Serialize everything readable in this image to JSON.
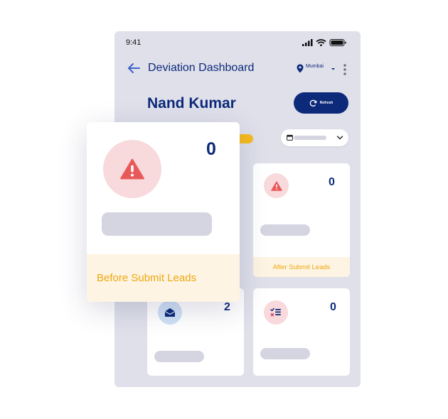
{
  "status_bar": {
    "time": "9:41"
  },
  "header": {
    "title": "Deviation Dashboard",
    "location": "Mumbai"
  },
  "user": {
    "name": "Nand Kumar"
  },
  "refresh": {
    "label": "Refresh"
  },
  "colors": {
    "brand_navy": "#0d2a7a",
    "accent_yellow": "#f7bb1f",
    "footer_bg": "#fdf4e3",
    "footer_text": "#eea80e",
    "warning_red": "#e85a5a",
    "screen_bg": "#dfe0ea"
  },
  "featured_card": {
    "count": "0",
    "label": "Before Submit Leads",
    "icon": "warning-icon"
  },
  "cards": [
    {
      "count": "0",
      "label": "After Submit Leads",
      "icon": "warning-icon"
    },
    {
      "count": "2",
      "icon": "envelope-icon"
    },
    {
      "count": "0",
      "icon": "checklist-icon"
    }
  ]
}
